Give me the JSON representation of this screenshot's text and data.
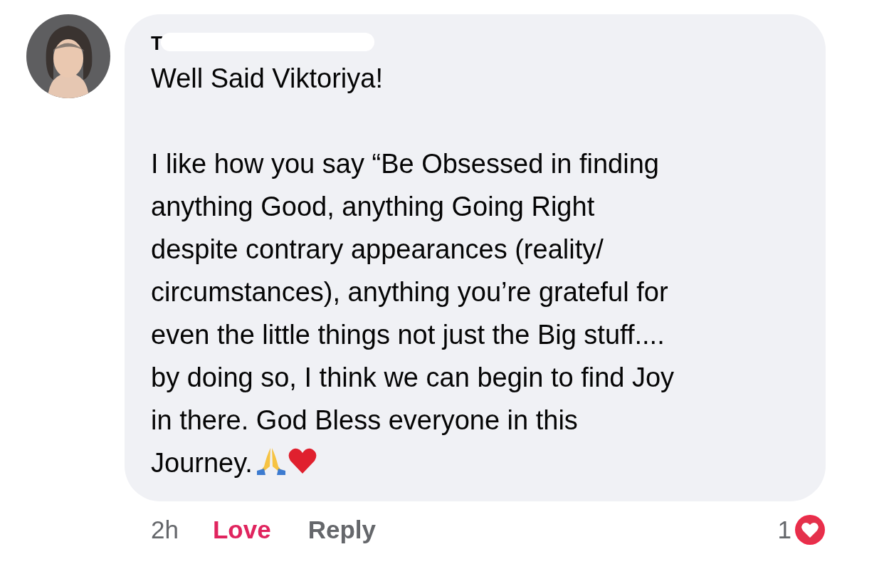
{
  "comment": {
    "author": "T",
    "paragraphs": [
      "Well Said Viktoriya!",
      "I like how you say “Be Obsessed in finding\nanything Good, anything Going Right\ndespite contrary appearances (reality/\ncircumstances), anything you’re grateful for\neven the little things not just the Big stuff....\nby doing so, I think we can begin to find Joy\nin there. God Bless everyone in this"
    ],
    "closing": "Journey.",
    "time": "2h",
    "reaction": {
      "label": "Love",
      "selected": true
    },
    "reply": "Reply",
    "reaction_count": "1"
  }
}
